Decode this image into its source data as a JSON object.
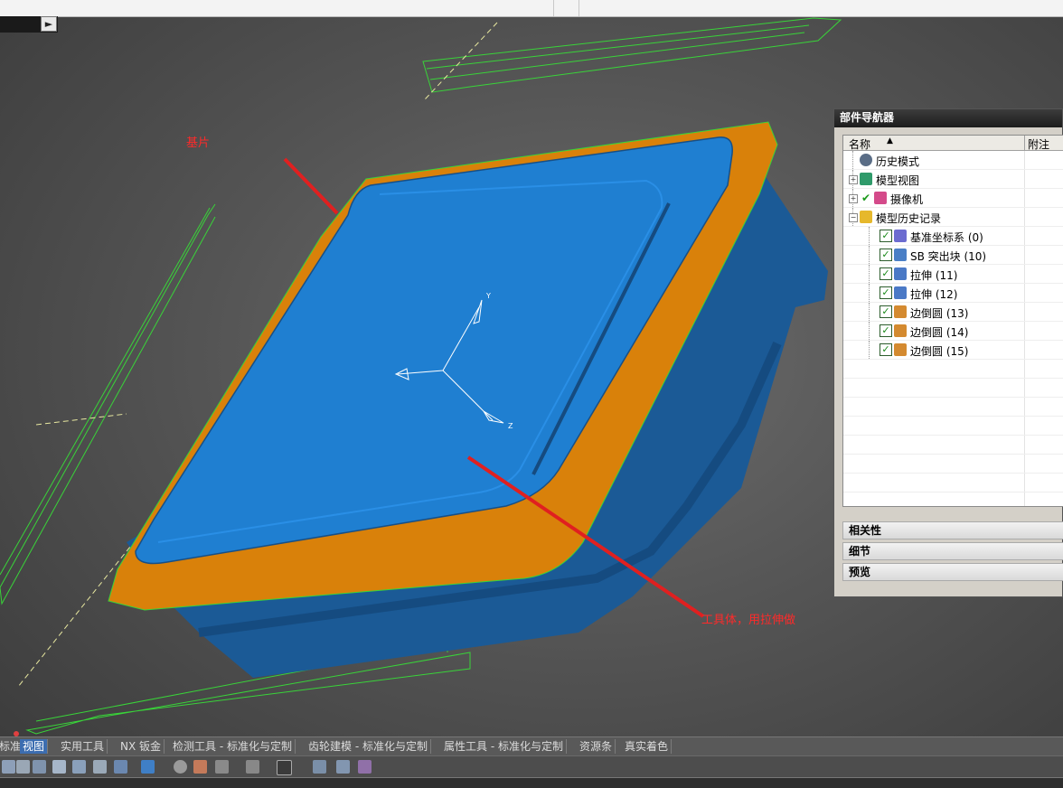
{
  "annotations": {
    "base_sheet": "基片",
    "tool_body": "工具体，用拉伸做"
  },
  "navigator": {
    "title": "部件导航器",
    "col_name": "名称",
    "col_note": "附注",
    "items": [
      {
        "label": "历史模式",
        "icon": "clock-icon"
      },
      {
        "label": "模型视图",
        "icon": "model-views-icon",
        "expander": "+"
      },
      {
        "label": "摄像机",
        "icon": "camera-icon",
        "expander": "+"
      },
      {
        "label": "模型历史记录",
        "icon": "folder-open-icon",
        "expander": "−"
      },
      {
        "label": "基准坐标系 (0)",
        "icon": "datum-csys-icon",
        "checked": true
      },
      {
        "label": "SB 突出块 (10)",
        "icon": "tab-feature-icon",
        "checked": true
      },
      {
        "label": "拉伸 (11)",
        "icon": "extrude-icon",
        "checked": true
      },
      {
        "label": "拉伸 (12)",
        "icon": "extrude-icon",
        "checked": true
      },
      {
        "label": "边倒圆 (13)",
        "icon": "edge-blend-icon",
        "checked": true
      },
      {
        "label": "边倒圆 (14)",
        "icon": "edge-blend-icon",
        "checked": true
      },
      {
        "label": "边倒圆 (15)",
        "icon": "edge-blend-icon",
        "checked": true
      }
    ],
    "sections": [
      "相关性",
      "细节",
      "预览"
    ]
  },
  "tabs": [
    "标准",
    "视图",
    "实用工具",
    "NX 钣金",
    "检测工具 - 标准化与定制",
    "齿轮建模 - 标准化与定制",
    "属性工具 - 标准化与定制",
    "资源条",
    "真实着色"
  ],
  "active_tab": "视图",
  "axis_labels": {
    "y": "Y",
    "z": "Z"
  },
  "colors": {
    "part_top": "#1f7fd1",
    "part_body": "#1b5a96",
    "flange": "#d9810a",
    "wire": "#39d439",
    "annotation": "#ff2a2a"
  }
}
